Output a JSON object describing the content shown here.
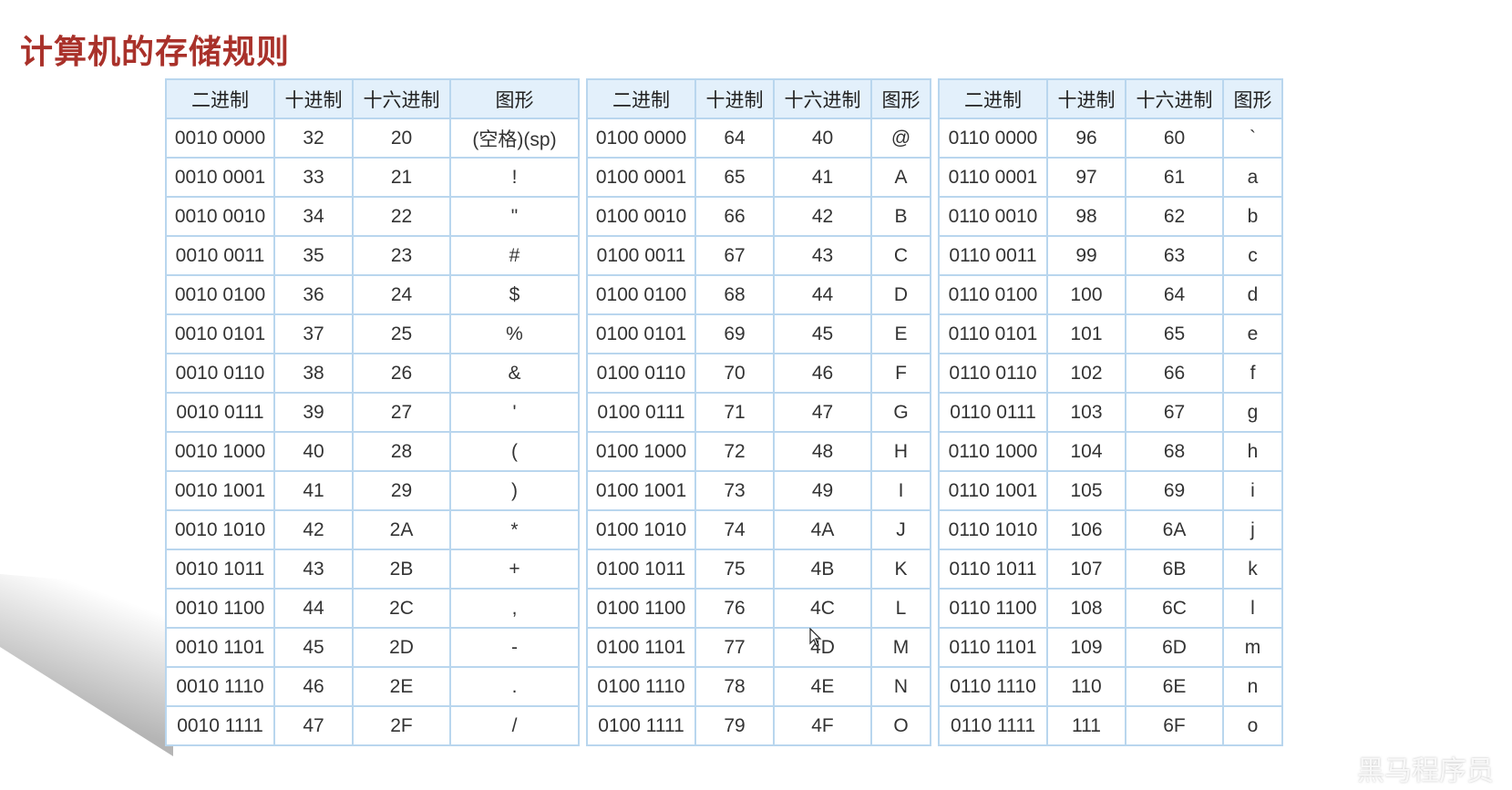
{
  "title": "计算机的存储规则",
  "headers": [
    "二进制",
    "十进制",
    "十六进制",
    "图形"
  ],
  "tables": [
    {
      "rows": [
        [
          "0010 0000",
          "32",
          "20",
          "(空格)(sp)"
        ],
        [
          "0010 0001",
          "33",
          "21",
          "!"
        ],
        [
          "0010 0010",
          "34",
          "22",
          "\""
        ],
        [
          "0010 0011",
          "35",
          "23",
          "#"
        ],
        [
          "0010 0100",
          "36",
          "24",
          "$"
        ],
        [
          "0010 0101",
          "37",
          "25",
          "%"
        ],
        [
          "0010 0110",
          "38",
          "26",
          "&"
        ],
        [
          "0010 0111",
          "39",
          "27",
          "'"
        ],
        [
          "0010 1000",
          "40",
          "28",
          "("
        ],
        [
          "0010 1001",
          "41",
          "29",
          ")"
        ],
        [
          "0010 1010",
          "42",
          "2A",
          "*"
        ],
        [
          "0010 1011",
          "43",
          "2B",
          "+"
        ],
        [
          "0010 1100",
          "44",
          "2C",
          ","
        ],
        [
          "0010 1101",
          "45",
          "2D",
          "-"
        ],
        [
          "0010 1110",
          "46",
          "2E",
          "."
        ],
        [
          "0010 1111",
          "47",
          "2F",
          "/"
        ]
      ]
    },
    {
      "rows": [
        [
          "0100 0000",
          "64",
          "40",
          "@"
        ],
        [
          "0100 0001",
          "65",
          "41",
          "A"
        ],
        [
          "0100 0010",
          "66",
          "42",
          "B"
        ],
        [
          "0100 0011",
          "67",
          "43",
          "C"
        ],
        [
          "0100 0100",
          "68",
          "44",
          "D"
        ],
        [
          "0100 0101",
          "69",
          "45",
          "E"
        ],
        [
          "0100 0110",
          "70",
          "46",
          "F"
        ],
        [
          "0100 0111",
          "71",
          "47",
          "G"
        ],
        [
          "0100 1000",
          "72",
          "48",
          "H"
        ],
        [
          "0100 1001",
          "73",
          "49",
          "I"
        ],
        [
          "0100 1010",
          "74",
          "4A",
          "J"
        ],
        [
          "0100 1011",
          "75",
          "4B",
          "K"
        ],
        [
          "0100 1100",
          "76",
          "4C",
          "L"
        ],
        [
          "0100 1101",
          "77",
          "4D",
          "M"
        ],
        [
          "0100 1110",
          "78",
          "4E",
          "N"
        ],
        [
          "0100 1111",
          "79",
          "4F",
          "O"
        ]
      ]
    },
    {
      "rows": [
        [
          "0110 0000",
          "96",
          "60",
          "`"
        ],
        [
          "0110 0001",
          "97",
          "61",
          "a"
        ],
        [
          "0110 0010",
          "98",
          "62",
          "b"
        ],
        [
          "0110 0011",
          "99",
          "63",
          "c"
        ],
        [
          "0110 0100",
          "100",
          "64",
          "d"
        ],
        [
          "0110 0101",
          "101",
          "65",
          "e"
        ],
        [
          "0110 0110",
          "102",
          "66",
          "f"
        ],
        [
          "0110 0111",
          "103",
          "67",
          "g"
        ],
        [
          "0110 1000",
          "104",
          "68",
          "h"
        ],
        [
          "0110 1001",
          "105",
          "69",
          "i"
        ],
        [
          "0110 1010",
          "106",
          "6A",
          "j"
        ],
        [
          "0110 1011",
          "107",
          "6B",
          "k"
        ],
        [
          "0110 1100",
          "108",
          "6C",
          "l"
        ],
        [
          "0110 1101",
          "109",
          "6D",
          "m"
        ],
        [
          "0110 1110",
          "110",
          "6E",
          "n"
        ],
        [
          "0110 1111",
          "111",
          "6F",
          "o"
        ]
      ]
    }
  ],
  "watermark": "黑马程序员",
  "colors": {
    "title": "#a9312a",
    "header_bg": "#e3f0fb",
    "border": "#b9d6ee"
  }
}
